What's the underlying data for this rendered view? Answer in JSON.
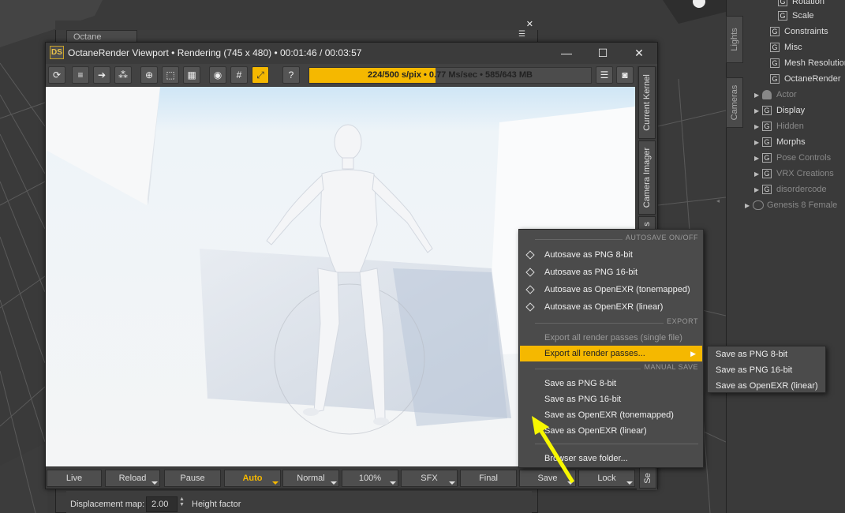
{
  "window": {
    "title": "OctaneRender Viewport • Rendering (745 x 480) • 00:01:46 / 00:03:57",
    "logo": "DS",
    "minimize": "—",
    "maximize": "☐",
    "close": "✕"
  },
  "background_panel": {
    "tab_label": "Octane",
    "close": "✕"
  },
  "toolbar": {
    "progress_text": "224/500 s/pix • 0.77 Ms/sec • 585/643 MB",
    "progress_fraction": 0.448,
    "icons": [
      "refresh-icon",
      "list-icon",
      "export-icon",
      "nodes-icon",
      "target-icon",
      "region-icon",
      "grid-view-icon",
      "circle-icon",
      "grid-icon",
      "expand-icon",
      "help-icon",
      "menu-icon",
      "camera-icon"
    ]
  },
  "side_tabs": [
    "Current Kernel",
    "Camera Imager",
    "s"
  ],
  "bottom_bar": {
    "live": "Live",
    "reload": "Reload",
    "pause": "Pause",
    "auto": "Auto",
    "normal": "Normal",
    "zoom": "100%",
    "sfx": "SFX",
    "final": "Final",
    "save": "Save",
    "lock": "Lock",
    "side": "Se"
  },
  "displacement": {
    "label": "Displacement map:",
    "value": "2.00",
    "suffix": "Height factor"
  },
  "menu": {
    "autosave_header": "AUTOSAVE ON/OFF",
    "autosave_items": [
      "Autosave as PNG 8-bit",
      "Autosave as PNG 16-bit",
      "Autosave as OpenEXR (tonemapped)",
      "Autosave as OpenEXR (linear)"
    ],
    "export_header": "EXPORT",
    "export_single": "Export all render passes (single file)",
    "export_all": "Export all render passes...",
    "manual_header": "MANUAL SAVE",
    "manual_items": [
      "Save as PNG 8-bit",
      "Save as PNG 16-bit",
      "Save as OpenEXR (tonemapped)",
      "Save as OpenEXR (linear)"
    ],
    "browse": "Browser save folder..."
  },
  "submenu": [
    "Save as PNG 8-bit",
    "Save as PNG 16-bit",
    "Save as OpenEXR (linear)"
  ],
  "right_panel": {
    "vtabs": [
      "Lights",
      "Cameras"
    ],
    "items": [
      {
        "label": "Rotation",
        "dim": false
      },
      {
        "label": "Scale",
        "dim": false
      },
      {
        "label": "Constraints",
        "dim": false
      },
      {
        "label": "Misc",
        "dim": false
      },
      {
        "label": "Mesh Resolution",
        "dim": false
      },
      {
        "label": "OctaneRender",
        "dim": false
      },
      {
        "label": "Actor",
        "dim": true
      },
      {
        "label": "Display",
        "dim": false
      },
      {
        "label": "Hidden",
        "dim": true
      },
      {
        "label": "Morphs",
        "dim": false
      },
      {
        "label": "Pose Controls",
        "dim": true
      },
      {
        "label": "VRX Creations",
        "dim": true
      },
      {
        "label": "disordercode",
        "dim": true
      },
      {
        "label": "Genesis 8 Female",
        "dim": true
      }
    ]
  },
  "colors": {
    "accent": "#f5b800",
    "arrow": "#f7f700"
  }
}
